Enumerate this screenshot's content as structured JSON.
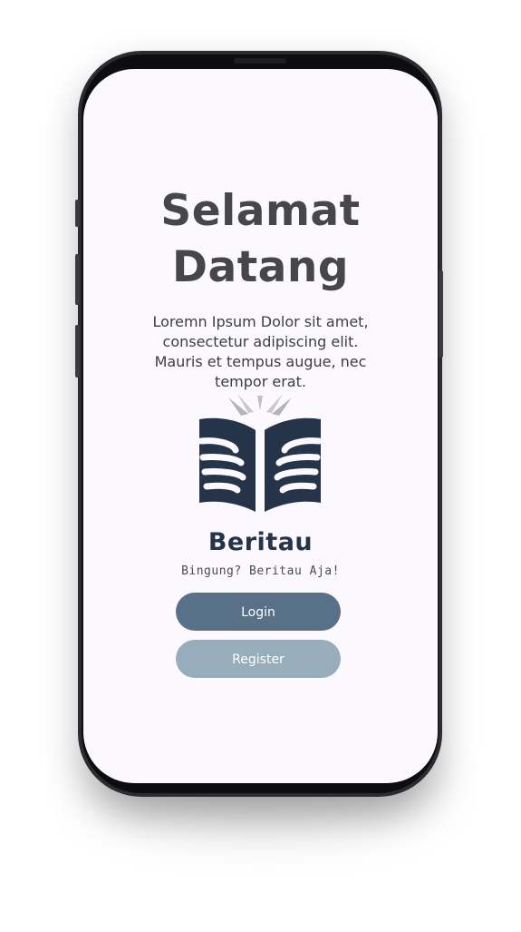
{
  "welcome": {
    "title_line1": "Selamat",
    "title_line2": "Datang",
    "description": "Loremn Ipsum Dolor sit amet, consectetur adipiscing elit. Mauris et tempus augue, nec tempor erat."
  },
  "brand": {
    "name": "Beritau",
    "tagline": "Bingung? Beritau Aja!",
    "logo_icon": "open-book-hands-icon"
  },
  "actions": {
    "login_label": "Login",
    "register_label": "Register"
  },
  "colors": {
    "screen_background": "#fbf9fd",
    "title_text": "#46464b",
    "brand_navy": "#263449",
    "login_button": "#587088",
    "register_button": "#98adbb",
    "logo_rays": "#b3b3b3"
  }
}
